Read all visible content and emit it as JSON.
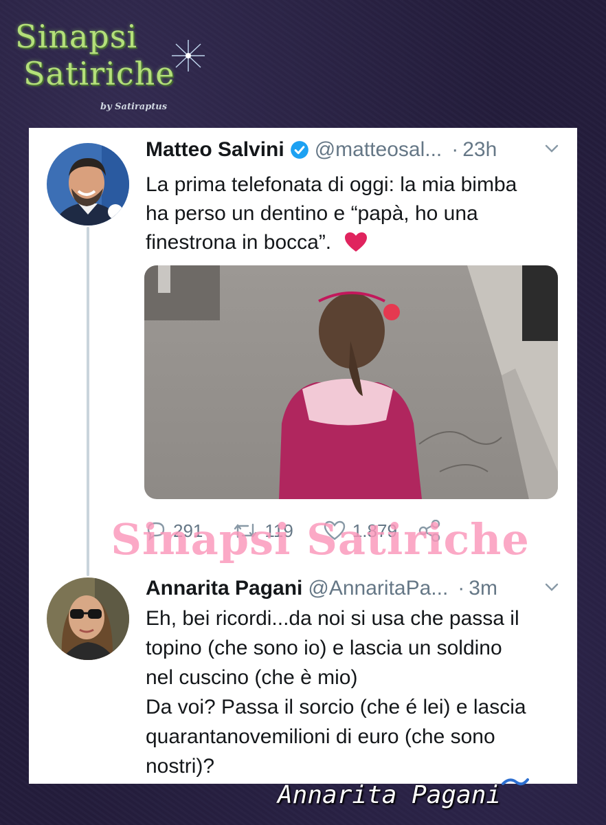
{
  "logo": {
    "line1": "Sinapsi",
    "line2": "Satiriche",
    "by_text": "by Satiraptus"
  },
  "tweets": [
    {
      "author": "Matteo Salvini",
      "handle": "@matteosal...",
      "separator": "·",
      "time": "23h",
      "text_lines": [
        "La prima telefonata di oggi: la mia bimba",
        "ha perso un dentino e “papà, ho una",
        "finestrona in bocca”."
      ],
      "replies": "291",
      "retweets": "119",
      "likes": "1.879"
    },
    {
      "author": "Annarita Pagani",
      "handle": "@AnnaritaPa...",
      "separator": "·",
      "time": "3m",
      "text_lines": [
        "Eh, bei ricordi...da noi si usa che passa il",
        "topino (che sono io) e lascia un soldino",
        "nel cuscino (che è mio)",
        "Da voi? Passa il sorcio (che é lei) e lascia",
        "quarantanovemilioni di euro (che sono",
        "nostri)?"
      ]
    }
  ],
  "watermark": "Sinapsi Satiriche",
  "signature": "Annarita Pagani",
  "colors": {
    "verified": "#1da1f2",
    "heart": "#e0245e",
    "watermark": "#f896b9",
    "background": "#241d3c"
  },
  "icons": [
    "reply-icon",
    "retweet-icon",
    "like-icon",
    "share-icon",
    "verified-badge-icon",
    "chevron-down-icon",
    "heart-emoji-icon"
  ]
}
